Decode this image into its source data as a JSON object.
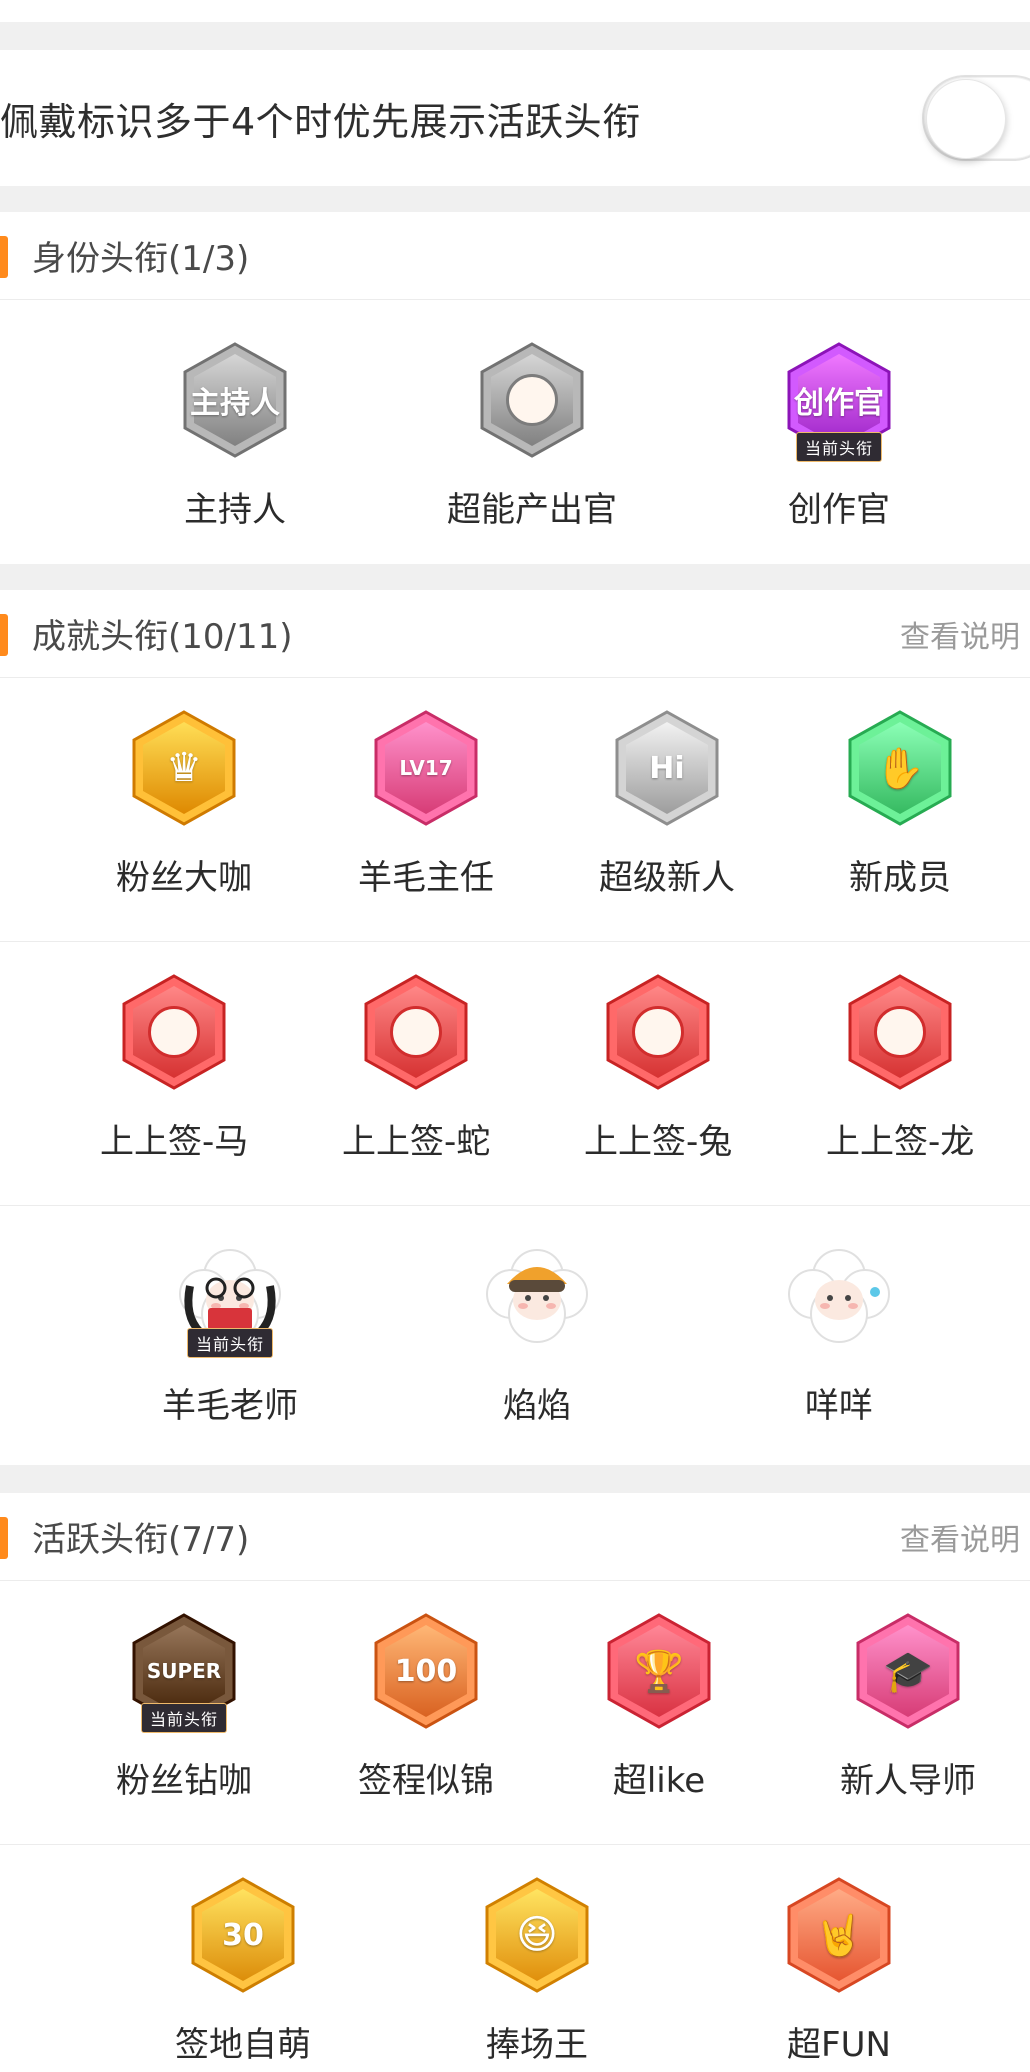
{
  "settings": {
    "priority_toggle_label": "佩戴标识多于4个时优先展示活跃头衔",
    "priority_toggle_on": false
  },
  "identity": {
    "title": "身份头衔(1/3)",
    "items": [
      {
        "name": "主持人",
        "icon": "microphone-badge-icon",
        "color": "#9a9a9a",
        "current": false,
        "inner_text": "主持人"
      },
      {
        "name": "超能产出官",
        "icon": "mascot-badge-icon",
        "color": "#9a9a9a",
        "current": false
      },
      {
        "name": "创作官",
        "icon": "hand-sign-badge-icon",
        "color": "#b43ce0",
        "current": true,
        "inner_text": "创作官"
      }
    ]
  },
  "achievement": {
    "title": "成就头衔(10/11)",
    "link": "查看说明",
    "row1": [
      {
        "name": "粉丝大咖",
        "icon": "crown-badge-icon",
        "color": "#f7a21a",
        "glyph": "♛"
      },
      {
        "name": "羊毛主任",
        "icon": "level-badge-icon",
        "color": "#f0558f",
        "inner_text": "LV17"
      },
      {
        "name": "超级新人",
        "icon": "hi-badge-icon",
        "color": "#b6b6b6",
        "inner_text": "Hi"
      },
      {
        "name": "新成员",
        "icon": "wave-hand-badge-icon",
        "color": "#4fd37a",
        "glyph": "✋"
      }
    ],
    "row2": [
      {
        "name": "上上签-马",
        "icon": "horse-badge-icon",
        "color": "#ef4b4b"
      },
      {
        "name": "上上签-蛇",
        "icon": "snake-badge-icon",
        "color": "#ef4b4b"
      },
      {
        "name": "上上签-兔",
        "icon": "rabbit-badge-icon",
        "color": "#ef4b4b"
      },
      {
        "name": "上上签-龙",
        "icon": "dragon-badge-icon",
        "color": "#ef4b4b"
      }
    ],
    "row3": [
      {
        "name": "羊毛老师",
        "icon": "sheep-teacher-avatar-icon",
        "current": true
      },
      {
        "name": "焰焰",
        "icon": "sheep-helmet-avatar-icon",
        "current": false
      },
      {
        "name": "咩咩",
        "icon": "sheep-cloud-avatar-icon",
        "current": false
      }
    ]
  },
  "active": {
    "title": "活跃头衔(7/7)",
    "link": "查看说明",
    "row1": [
      {
        "name": "粉丝钻咖",
        "icon": "super-badge-icon",
        "color": "#5b3a1e",
        "current": true,
        "inner_text": "SUPER"
      },
      {
        "name": "签程似锦",
        "icon": "days-100-badge-icon",
        "color": "#f27b3a",
        "inner_text": "100"
      },
      {
        "name": "超like",
        "icon": "trophy-badge-icon",
        "color": "#f24b5b",
        "glyph": "🏆"
      },
      {
        "name": "新人导师",
        "icon": "graduation-cap-badge-icon",
        "color": "#f0558f",
        "glyph": "🎓"
      }
    ],
    "row2": [
      {
        "name": "签地自萌",
        "icon": "days-30-badge-icon",
        "color": "#f5a623",
        "inner_text": "30"
      },
      {
        "name": "捧场王",
        "icon": "cheer-badge-icon",
        "color": "#f9a825",
        "glyph": "😆"
      },
      {
        "name": "超FUN",
        "icon": "rock-hand-badge-icon",
        "color": "#ff6f4a",
        "glyph": "🤘"
      }
    ]
  },
  "labels": {
    "current_title_tag": "当前头衔"
  }
}
